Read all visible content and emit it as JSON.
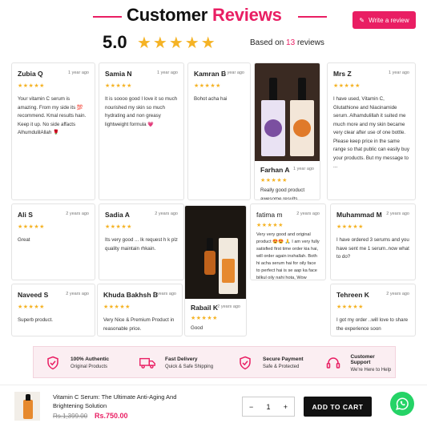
{
  "header": {
    "title_main": "Customer",
    "title_accent": "Reviews",
    "write_review": "Write a review",
    "average": "5.0",
    "stars": "★★★★★",
    "based_on_prefix": "Based on",
    "review_count": "13",
    "based_on_suffix": "reviews"
  },
  "reviews": [
    {
      "name": "Zubia Q",
      "time": "1 year ago",
      "stars": "★★★★★",
      "text": "Your vitamin C serum is amazing. From my side its 💯 recommend. Kmal results hain. Keep it up. No side affacts AlhumdulilAllah 🌹"
    },
    {
      "name": "Samia N",
      "time": "1 year ago",
      "stars": "★★★★★",
      "text": "It is soooo good I love it so much nourished my skin so much hydrating and non greasy lightweight formula 💗"
    },
    {
      "name": "Kamran B",
      "time": "1 year ago",
      "stars": "★★★★★",
      "text": "Bohot acha hai"
    },
    {
      "name": "Farhan A",
      "time": "1 year ago",
      "stars": "★★★★★",
      "text": "Really good product awesome results"
    },
    {
      "name": "Mrs Z",
      "time": "1 year ago",
      "stars": "★★★★★",
      "text": "I have used, Vitamin C, Glutathione and Niacinamide serum. Alhamdulillah it suited me much more and my skin became very clear after use of one bottle. Please keep price in the same range so that public can easily buy your products. But my message to ..."
    },
    {
      "name": "Ali S",
      "time": "2 years ago",
      "stars": "★★★★★",
      "text": "Great"
    },
    {
      "name": "Sadia A",
      "time": "2 years ago",
      "stars": "★★★★★",
      "text": "Its very good ... Ik request h k plz quality maintain rhkain."
    },
    {
      "name": "Rabail K",
      "time": "2 years ago",
      "stars": "★★★★★",
      "text": "Good"
    },
    {
      "name": "fatima m",
      "time": "2 years ago",
      "stars": "★★★★★",
      "text": "Very very good and original product 😍😍 🙏 I am very fully satisfied first time order kia hai, will order again inshallah. Both hi acha serum hai for oily face to perfect hai is se aap ka face bilkul oily nahi hota, Wow amazing.I received serum a..."
    },
    {
      "name": "Muhammad M",
      "time": "2 years ago",
      "stars": "★★★★★",
      "text": "I have ordered 3 serums and you have sent me 1 serum..now what to do?"
    },
    {
      "name": "Naveed S",
      "time": "2 years ago",
      "stars": "★★★★★",
      "text": "Superb product."
    },
    {
      "name": "Khuda Bakhsh B",
      "time": "2 years ago",
      "stars": "★★★★★",
      "text": "Very Nice & Premium Product in reasonable price."
    },
    {
      "name": "Tehreen K",
      "time": "2 years ago",
      "stars": "★★★★★",
      "text": "I got my order ..will love to share the experience soon"
    }
  ],
  "features": [
    {
      "icon": "shield-check-icon",
      "title": "100% Authentic",
      "sub": "Original Products"
    },
    {
      "icon": "truck-icon",
      "title": "Fast Delivery",
      "sub": "Quick & Safe Shipping"
    },
    {
      "icon": "shield-check-icon",
      "title": "Secure Payment",
      "sub": "Safe & Protected"
    },
    {
      "icon": "headset-icon",
      "title": "Customer Support",
      "sub": "We're Here to Help"
    }
  ],
  "footer": {
    "product_name": "Vitamin C Serum: The Ultimate Anti-Aging And Brightening Solution",
    "old_price": "Rs.1,399.00",
    "new_price": "Rs.750.00",
    "qty_minus": "−",
    "qty_value": "1",
    "qty_plus": "+",
    "add_to_cart": "ADD TO CART"
  },
  "colors": {
    "accent": "#e91e63",
    "star": "#f5b325",
    "whatsapp": "#25d366"
  }
}
